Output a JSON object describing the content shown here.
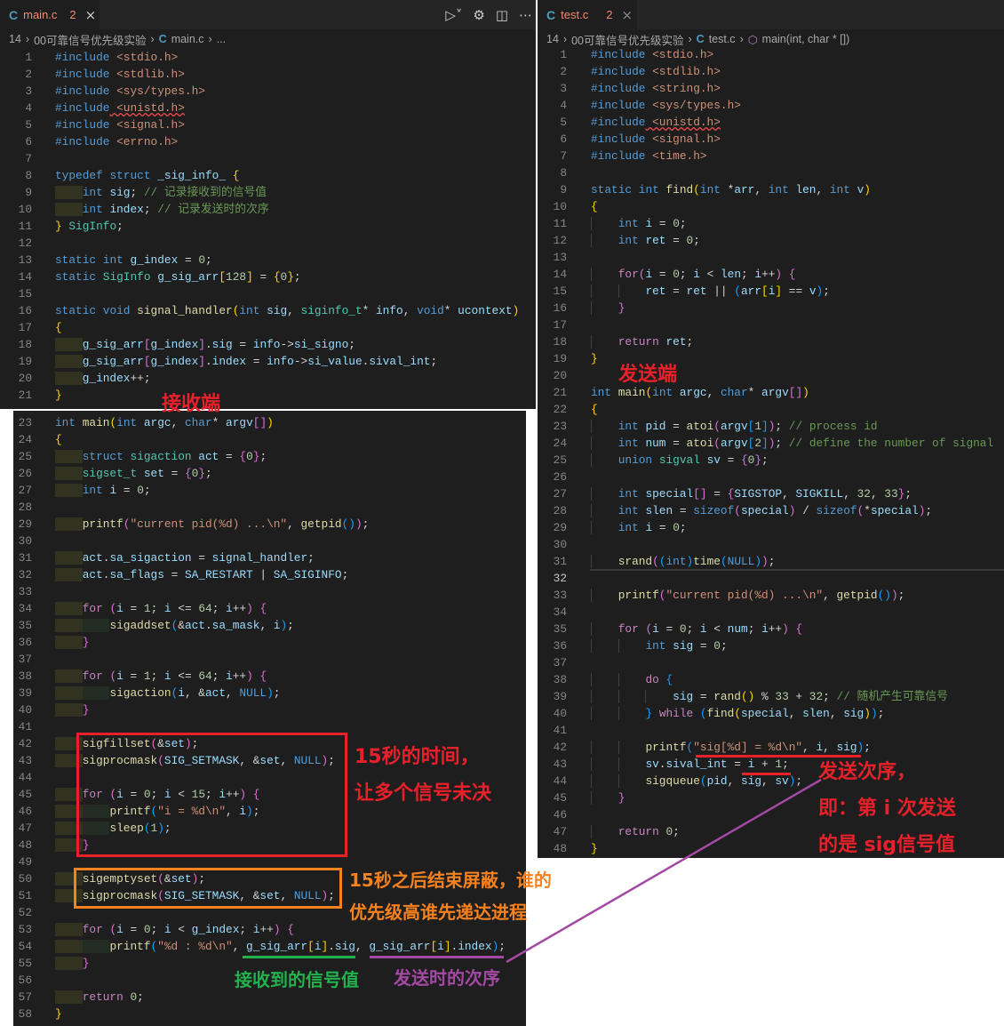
{
  "colors": {
    "red": "#e8202a",
    "orange": "#f5821f",
    "green": "#22b14c",
    "purple": "#a349a4"
  },
  "left_editor": {
    "tab": {
      "icon": "C",
      "name": "main.c",
      "problems": "2",
      "close": "×"
    },
    "actions": [
      "run-debug-icon",
      "gear-icon",
      "split-editor-icon",
      "more-icon"
    ],
    "breadcrumb": [
      "14",
      "00可靠信号优先级实验",
      "main.c",
      "..."
    ],
    "start": 1,
    "error_lines": [
      4
    ],
    "lines": [
      "#include <stdio.h>",
      "#include <stdlib.h>",
      "#include <sys/types.h>",
      "#include <unistd.h>",
      "#include <signal.h>",
      "#include <errno.h>",
      "",
      "typedef struct _sig_info_ {",
      "    int sig; // 记录接收到的信号值",
      "    int index; // 记录发送时的次序",
      "} SigInfo;",
      "",
      "static int g_index = 0;",
      "static SigInfo g_sig_arr[128] = {0};",
      "",
      "static void signal_handler(int sig, siginfo_t* info, void* ucontext)",
      "{",
      "    g_sig_arr[g_index].sig = info->si_signo;",
      "    g_sig_arr[g_index].index = info->si_value.sival_int;",
      "    g_index++;",
      "}"
    ]
  },
  "left_main": {
    "start": 23,
    "lines": [
      "int main(int argc, char* argv[])",
      "{",
      "    struct sigaction act = {0};",
      "    sigset_t set = {0};",
      "    int i = 0;",
      "",
      "    printf(\"current pid(%d) ...\\n\", getpid());",
      "",
      "    act.sa_sigaction = signal_handler;",
      "    act.sa_flags = SA_RESTART | SA_SIGINFO;",
      "",
      "    for (i = 1; i <= 64; i++) {",
      "        sigaddset(&act.sa_mask, i);",
      "    }",
      "",
      "    for (i = 1; i <= 64; i++) {",
      "        sigaction(i, &act, NULL);",
      "    }",
      "",
      "    sigfillset(&set);",
      "    sigprocmask(SIG_SETMASK, &set, NULL);",
      "",
      "    for (i = 0; i < 15; i++) {",
      "        printf(\"i = %d\\n\", i);",
      "        sleep(1);",
      "    }",
      "",
      "    sigemptyset(&set);",
      "    sigprocmask(SIG_SETMASK, &set, NULL);",
      "",
      "    for (i = 0; i < g_index; i++) {",
      "        printf(\"%d : %d\\n\", g_sig_arr[i].sig, g_sig_arr[i].index);",
      "    }",
      "",
      "    return 0;",
      "}"
    ]
  },
  "right_editor": {
    "tab": {
      "icon": "C",
      "name": "test.c",
      "problems": "2",
      "close": "×"
    },
    "breadcrumb": [
      "14",
      "00可靠信号优先级实验",
      "test.c",
      "main(int, char * [])"
    ],
    "start": 1,
    "current_line": 32,
    "error_lines": [
      5
    ],
    "lines": [
      "#include <stdio.h>",
      "#include <stdlib.h>",
      "#include <string.h>",
      "#include <sys/types.h>",
      "#include <unistd.h>",
      "#include <signal.h>",
      "#include <time.h>",
      "",
      "static int find(int *arr, int len, int v)",
      "{",
      "    int i = 0;",
      "    int ret = 0;",
      "",
      "    for(i = 0; i < len; i++) {",
      "        ret = ret || (arr[i] == v);",
      "    }",
      "",
      "    return ret;",
      "}",
      "",
      "int main(int argc, char* argv[])",
      "{",
      "    int pid = atoi(argv[1]); // process id",
      "    int num = atoi(argv[2]); // define the number of signal",
      "    union sigval sv = {0};",
      "",
      "    int special[] = {SIGSTOP, SIGKILL, 32, 33};",
      "    int slen = sizeof(special) / sizeof(*special);",
      "    int i = 0;",
      "",
      "    srand((int)time(NULL));",
      "",
      "    printf(\"current pid(%d) ...\\n\", getpid());",
      "",
      "    for (i = 0; i < num; i++) {",
      "        int sig = 0;",
      "",
      "        do {",
      "            sig = rand() % 33 + 32; // 随机产生可靠信号",
      "        } while (find(special, slen, sig));",
      "",
      "        printf(\"sig[%d] = %d\\n\", i, sig);",
      "        sv.sival_int = i + 1;",
      "        sigqueue(pid, sig, sv);",
      "    }",
      "",
      "    return 0;",
      "}"
    ]
  },
  "annotations": {
    "receiver": "接收端",
    "sender": "发送端",
    "block_note": [
      "15秒的时间，",
      "让多个信号未决"
    ],
    "unblock_note": [
      "15秒之后结束屏蔽，谁的",
      "优先级高谁先递达进程"
    ],
    "received_value": "接收到的信号值",
    "send_order": "发送时的次序",
    "send_note": [
      "发送次序，",
      "即：第 i 次发送",
      "的是 sig信号值"
    ]
  }
}
